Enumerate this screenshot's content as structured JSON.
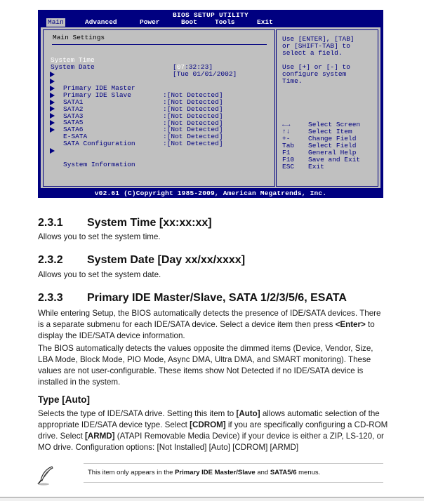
{
  "bios": {
    "title": "BIOS SETUP UTILITY",
    "tabs": [
      {
        "label": "Main",
        "active": true
      },
      {
        "label": "Advanced",
        "active": false
      },
      {
        "label": "Power",
        "active": false
      },
      {
        "label": "Boot",
        "active": false
      },
      {
        "label": "Tools",
        "active": false
      },
      {
        "label": "Exit",
        "active": false
      }
    ],
    "section_title": "Main Settings",
    "system_time": {
      "label": "System Time",
      "value_highlight": "07",
      "value_rest": ":32:23]",
      "value_open": "["
    },
    "system_date": {
      "label": "System Date",
      "value": "[Tue 01/01/2002]"
    },
    "devices": [
      {
        "label": "Primary IDE Master",
        "value": ":[Not Detected]"
      },
      {
        "label": "Primary IDE Slave",
        "value": ":[Not Detected]"
      },
      {
        "label": "SATA1",
        "value": ":[Not Detected]"
      },
      {
        "label": "SATA2",
        "value": ":[Not Detected]"
      },
      {
        "label": "SATA3",
        "value": ":[Not Detected]"
      },
      {
        "label": "SATA5",
        "value": ":[Not Detected]"
      },
      {
        "label": "SATA6",
        "value": ":[Not Detected]"
      },
      {
        "label": "E-SATA",
        "value": ":[Not Detected]"
      },
      {
        "label": "SATA Configuration",
        "value": ""
      }
    ],
    "system_information": "System Information",
    "help": {
      "line1": "Use [ENTER], [TAB]",
      "line2": "or [SHIFT-TAB] to",
      "line3": "select a field.",
      "line4": "Use [+] or [-] to",
      "line5": "configure system",
      "line6": "Time."
    },
    "keys": [
      {
        "key": "←→",
        "desc": "Select Screen"
      },
      {
        "key": "↑↓",
        "desc": "Select Item"
      },
      {
        "key": "+-",
        "desc": "Change Field"
      },
      {
        "key": "Tab",
        "desc": "Select Field"
      },
      {
        "key": "F1",
        "desc": "General Help"
      },
      {
        "key": "F10",
        "desc": "Save and Exit"
      },
      {
        "key": "ESC",
        "desc": "Exit"
      }
    ],
    "footer": "v02.61 (C)Copyright 1985-2009, American Megatrends, Inc."
  },
  "sections": [
    {
      "number": "2.3.1",
      "title": "System Time [xx:xx:xx]",
      "body": "Allows you to set the system time."
    },
    {
      "number": "2.3.2",
      "title": "System Date [Day xx/xx/xxxx]",
      "body": "Allows you to set the system date."
    },
    {
      "number": "2.3.3",
      "title": "Primary IDE Master/Slave, SATA 1/2/3/5/6, ESATA",
      "p1_a": "While entering Setup, the BIOS automatically detects the presence of IDE/SATA devices. There is a separate submenu for each IDE/SATA device. Select a device item then press ",
      "p1_bold": "<Enter>",
      "p1_b": " to display the IDE/SATA device information.",
      "p2": "The BIOS automatically detects the values opposite the dimmed items (Device, Vendor, Size, LBA Mode, Block Mode, PIO Mode, Async DMA, Ultra DMA, and SMART monitoring). These values are not user-configurable. These items show Not Detected if no IDE/SATA device is installed in the system."
    }
  ],
  "type_section": {
    "title": "Type [Auto]",
    "t1": "Selects the type of IDE/SATA drive. Setting this item to ",
    "b1": "[Auto]",
    "t2": " allows automatic selection of the appropriate IDE/SATA device type. Select ",
    "b2": "[CDROM]",
    "t3": " if you are specifically configuring a CD-ROM drive. Select ",
    "b3": "[ARMD]",
    "t4": " (ATAPI Removable Media Device) if your device is either a ZIP, LS-120, or MO drive. Configuration options: [Not Installed] [Auto] [CDROM] [ARMD]"
  },
  "note": {
    "icon": "feather-pen-icon",
    "t1": "This item only appears in the ",
    "b1": "Primary IDE Master/Slave",
    "t2": " and ",
    "b2": "SATA5/6",
    "t3": " menus."
  }
}
